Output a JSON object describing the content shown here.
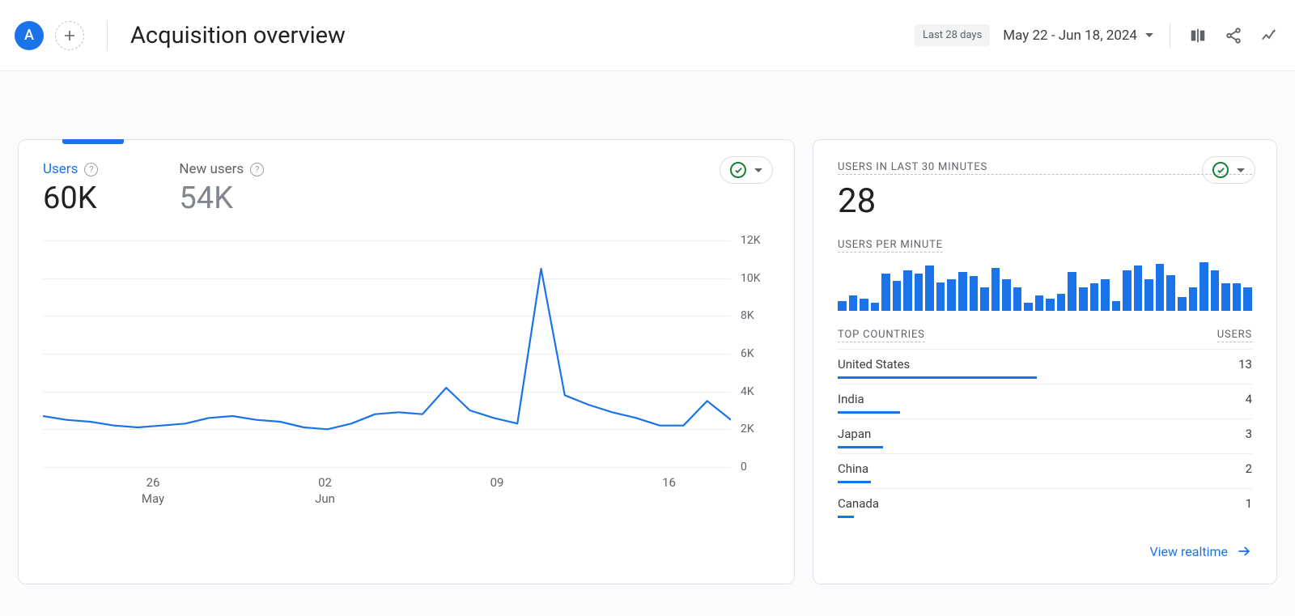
{
  "header": {
    "avatar_letter": "A",
    "title": "Acquisition overview",
    "date_pill": "Last 28 days",
    "date_range": "May 22 - Jun 18, 2024"
  },
  "metrics": {
    "users": {
      "label": "Users",
      "value": "60K"
    },
    "new_users": {
      "label": "New users",
      "value": "54K"
    }
  },
  "chart_data": {
    "type": "line",
    "x_ticks": [
      {
        "day": "26",
        "month": "May",
        "pos_pct": 16
      },
      {
        "day": "02",
        "month": "Jun",
        "pos_pct": 41
      },
      {
        "day": "09",
        "month": "",
        "pos_pct": 66
      },
      {
        "day": "16",
        "month": "",
        "pos_pct": 91
      }
    ],
    "y_ticks": [
      "12K",
      "10K",
      "8K",
      "6K",
      "4K",
      "2K",
      "0"
    ],
    "ylim": [
      0,
      12000
    ],
    "series": [
      {
        "name": "Users",
        "values": [
          2700,
          2500,
          2400,
          2200,
          2100,
          2200,
          2300,
          2600,
          2700,
          2500,
          2400,
          2100,
          2000,
          2300,
          2800,
          2900,
          2800,
          4200,
          3000,
          2600,
          2300,
          10500,
          3800,
          3300,
          2900,
          2600,
          2200,
          2200,
          3500,
          2500
        ]
      }
    ]
  },
  "realtime": {
    "last_30_label": "USERS IN LAST 30 MINUTES",
    "last_30_value": "28",
    "per_minute_label": "USERS PER MINUTE",
    "per_minute_bars": [
      12,
      20,
      15,
      10,
      48,
      38,
      52,
      48,
      58,
      36,
      40,
      50,
      44,
      30,
      55,
      40,
      30,
      10,
      20,
      15,
      22,
      50,
      30,
      35,
      40,
      12,
      52,
      58,
      40,
      60,
      45,
      18,
      30,
      62,
      52,
      35,
      35,
      30
    ],
    "top_countries_label": "TOP COUNTRIES",
    "users_col_label": "USERS",
    "countries": [
      {
        "name": "United States",
        "users": 13,
        "bar_pct": 48
      },
      {
        "name": "India",
        "users": 4,
        "bar_pct": 15
      },
      {
        "name": "Japan",
        "users": 3,
        "bar_pct": 11
      },
      {
        "name": "China",
        "users": 2,
        "bar_pct": 8
      },
      {
        "name": "Canada",
        "users": 1,
        "bar_pct": 4
      }
    ],
    "view_link": "View realtime"
  }
}
